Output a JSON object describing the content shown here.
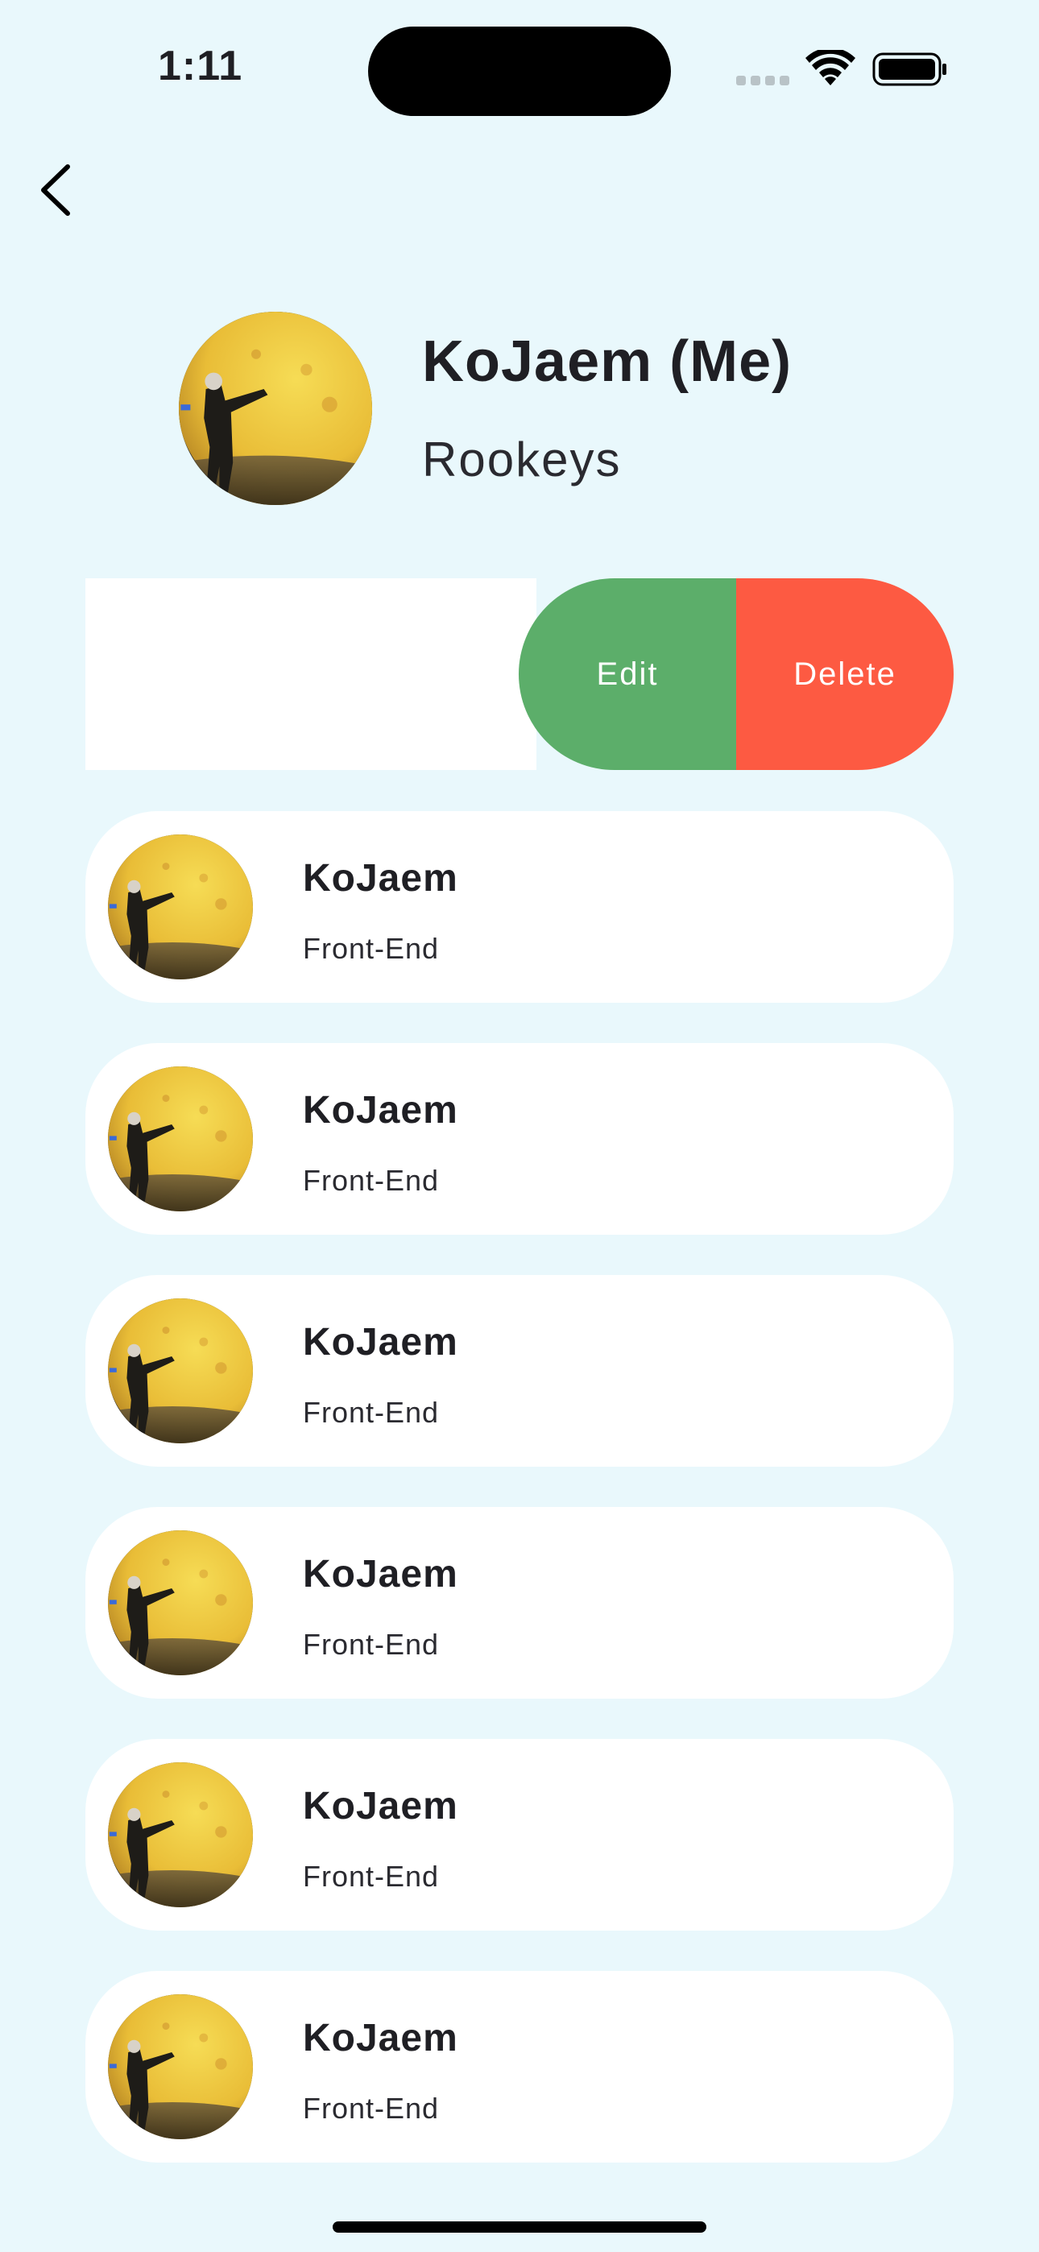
{
  "status_bar": {
    "time": "1:11"
  },
  "profile": {
    "name": "KoJaem (Me)",
    "team": "Rookeys"
  },
  "swipe_actions": {
    "edit_label": "Edit",
    "delete_label": "Delete"
  },
  "members": [
    {
      "name": "KoJaem",
      "role": "Front-End"
    },
    {
      "name": "KoJaem",
      "role": "Front-End"
    },
    {
      "name": "KoJaem",
      "role": "Front-End"
    },
    {
      "name": "KoJaem",
      "role": "Front-End"
    },
    {
      "name": "KoJaem",
      "role": "Front-End"
    },
    {
      "name": "KoJaem",
      "role": "Front-End"
    }
  ],
  "colors": {
    "background": "#e9f8fc",
    "edit": "#5cae6a",
    "delete": "#fd5a42",
    "card": "#ffffff"
  },
  "icons": [
    "chevron-left-icon",
    "wifi-icon",
    "battery-icon",
    "signal-icon"
  ]
}
